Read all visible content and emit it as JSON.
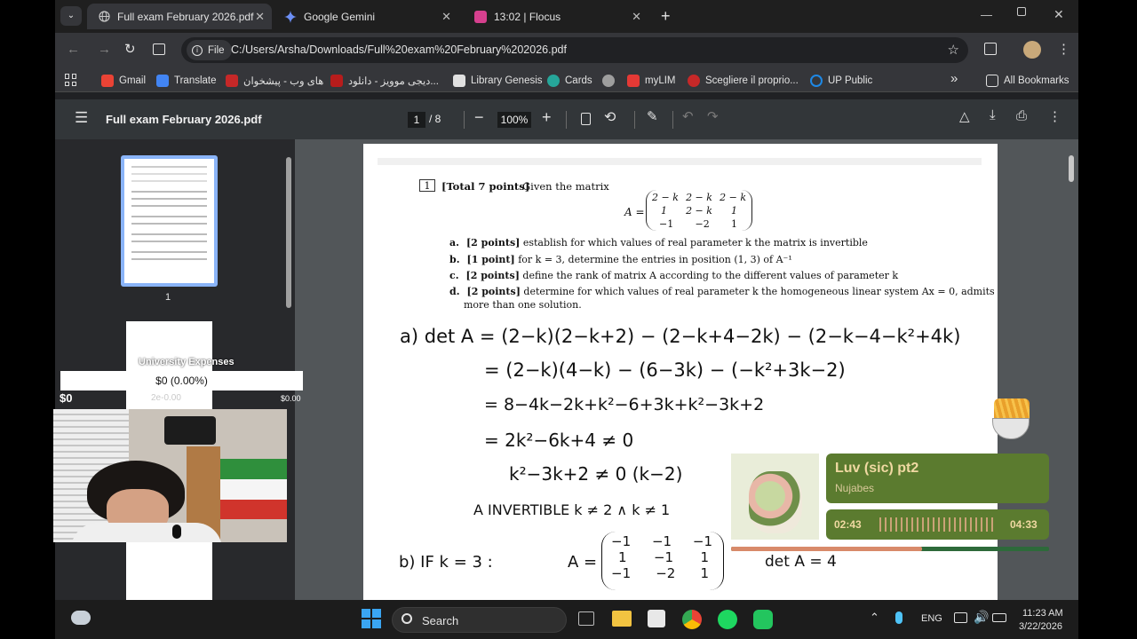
{
  "tabs": [
    {
      "label": "Full exam February 2026.pdf",
      "active": true
    },
    {
      "label": "Google Gemini",
      "active": false
    },
    {
      "label": "13:02 | Flocus",
      "active": false
    }
  ],
  "toolbar": {
    "file_chip": "File",
    "url": "C:/Users/Arsha/Downloads/Full%20exam%20February%202026.pdf"
  },
  "bookmarks": {
    "items": [
      {
        "label": "Gmail",
        "color": "#ea4335"
      },
      {
        "label": "Translate",
        "color": "#4285f4"
      },
      {
        "label": "های وب - پیشخوان",
        "color": "#c62828"
      },
      {
        "label": "دیجی موویز - دانلود...",
        "color": "#b71c1c"
      },
      {
        "label": "Library Genesis",
        "color": "#e0e0e0"
      },
      {
        "label": "Cards",
        "color": "#26a69a"
      },
      {
        "label": "",
        "color": "#9e9e9e"
      },
      {
        "label": "myLIM",
        "color": "#e53935"
      },
      {
        "label": "Scegliere il proprio...",
        "color": "#c62828"
      },
      {
        "label": "UP Public",
        "color": "#1e88e5"
      }
    ],
    "overflow": "»",
    "all_label": "All Bookmarks"
  },
  "pdf": {
    "title": "Full exam February 2026.pdf",
    "page_current": "1",
    "page_total": "/ 8",
    "zoom": "100%",
    "thumb_label_1": "1"
  },
  "page": {
    "qnum": "1",
    "q_head_bold": "[Total 7 points]",
    "q_head_rest": "Given the matrix",
    "matrix_label": "A =",
    "matrix": [
      [
        "2 − k",
        "2 − k",
        "2 − k"
      ],
      [
        "1",
        "2 − k",
        "1"
      ],
      [
        "−1",
        "−2",
        "1"
      ]
    ],
    "parts": [
      {
        "letter": "a.",
        "pts": "[2 points]",
        "text": "establish for which values of real parameter k the matrix is invertible"
      },
      {
        "letter": "b.",
        "pts": "[1 point]",
        "text": "for k = 3, determine the entries in position (1, 3) of A⁻¹"
      },
      {
        "letter": "c.",
        "pts": "[2 points]",
        "text": "define the rank of matrix A according to the different values of parameter k"
      },
      {
        "letter": "d.",
        "pts": "[2 points]",
        "text": "determine for which values of real parameter k the homogeneous linear system Ax = 0, admits"
      }
    ],
    "part_d_cont": "more than one solution.",
    "hw": [
      "a)  det A = (2−k)(2−k+2) − (2−k+4−2k) − (2−k−4−k²+4k)",
      "= (2−k)(4−k) − (6−3k) − (−k²+3k−2)",
      "= 8−4k−2k+k²−6+3k+k²−3k+2",
      "= 2k²−6k+4 ≠ 0",
      "k²−3k+2 ≠ 0      (k−2)",
      "A INVERTIBLE      k ≠ 2  ∧  k ≠ 1",
      "b)  IF k = 3    :",
      "A =",
      "det A = 4"
    ],
    "hw_matrix": [
      [
        "−1",
        "−1",
        "−1"
      ],
      [
        "1",
        "−1",
        "1"
      ],
      [
        "−1",
        "−2",
        "1"
      ]
    ]
  },
  "overlay": {
    "widget_title": "University Expenses",
    "amount_box": "$0 (0.00%)",
    "left_amount": "$0",
    "right_amount": "$0.00",
    "thumb_text": "2e-0.00"
  },
  "music": {
    "title": "Luv (sic) pt2",
    "artist": "Nujabes",
    "elapsed": "02:43",
    "duration": "04:33",
    "progress": 0.6
  },
  "taskbar": {
    "search_label": "Search",
    "lang": "ENG",
    "time": "11:23 AM",
    "date": "3/22/2026"
  }
}
